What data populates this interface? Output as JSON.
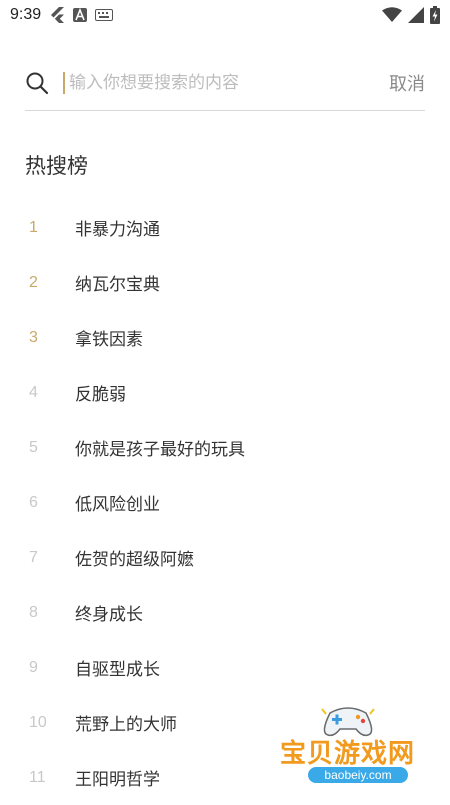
{
  "status_bar": {
    "time": "9:39",
    "left_icons": [
      "flutter-icon",
      "a-badge-icon",
      "keyboard-icon"
    ],
    "right_icons": [
      "wifi-icon",
      "signal-icon",
      "battery-charging-icon"
    ]
  },
  "search": {
    "placeholder": "输入你想要搜索的内容",
    "value": "",
    "cancel_label": "取消"
  },
  "hot": {
    "title": "热搜榜",
    "items": [
      {
        "rank": "1",
        "label": "非暴力沟通"
      },
      {
        "rank": "2",
        "label": "纳瓦尔宝典"
      },
      {
        "rank": "3",
        "label": "拿铁因素"
      },
      {
        "rank": "4",
        "label": "反脆弱"
      },
      {
        "rank": "5",
        "label": "你就是孩子最好的玩具"
      },
      {
        "rank": "6",
        "label": "低风险创业"
      },
      {
        "rank": "7",
        "label": "佐贺的超级阿嬷"
      },
      {
        "rank": "8",
        "label": "终身成长"
      },
      {
        "rank": "9",
        "label": "自驱型成长"
      },
      {
        "rank": "10",
        "label": "荒野上的大师"
      },
      {
        "rank": "11",
        "label": "王阳明哲学"
      }
    ]
  },
  "colors": {
    "accent": "#c9a96a",
    "rank_muted": "#c8c8c8"
  },
  "watermark": {
    "title": "宝贝游戏网",
    "url": "baobeiy.com"
  }
}
